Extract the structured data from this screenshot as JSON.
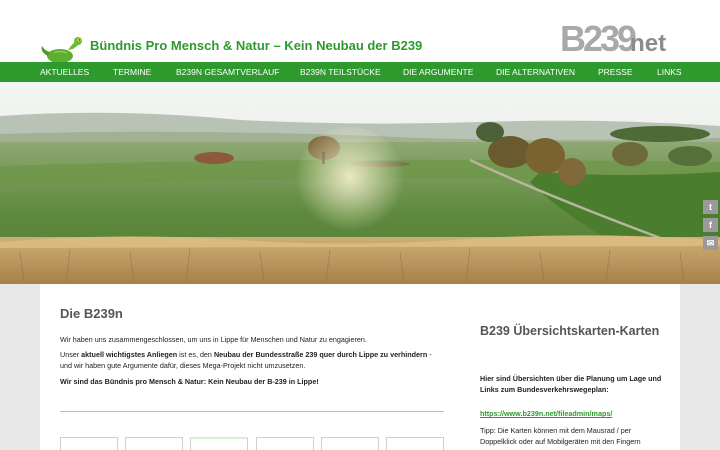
{
  "header": {
    "title": "Bündnis Pro Mensch & Natur – Kein Neubau der B239",
    "brand_main": "B239",
    "brand_sub": "net"
  },
  "nav": {
    "items": [
      {
        "label": "AKTUELLES"
      },
      {
        "label": "TERMINE"
      },
      {
        "label": "B239N GESAMTVERLAUF"
      },
      {
        "label": "B239N TEILSTÜCKE"
      },
      {
        "label": "DIE ARGUMENTE"
      },
      {
        "label": "DIE ALTERNATIVEN"
      },
      {
        "label": "PRESSE"
      },
      {
        "label": "LINKS"
      }
    ]
  },
  "share": {
    "twitter": "t",
    "facebook": "f",
    "email": "✉"
  },
  "main": {
    "title": "Die B239n",
    "p1": "Wir haben uns zusammengeschlossen, um uns in Lippe für Menschen und Natur zu engagieren.",
    "p2_a": "Unser ",
    "p2_b": "aktuell wichtigstes Anliegen",
    "p2_c": " ist es, den ",
    "p2_d": "Neubau der Bundesstraße 239 quer durch Lippe zu verhindern",
    "p2_e": " - und wir haben gute Argumente dafür, dieses Mega-Projekt nicht umzusetzen.",
    "p3": "Wir sind das Bündnis pro Mensch & Natur: Kein Neubau der B-239 in Lippe!"
  },
  "sidebar": {
    "title": "B239 Übersichtskarten-Karten",
    "intro": "Hier sind Übersichten über die Planung um Lage und Links zum Bundesverkehrswegeplan:",
    "link": "https://www.b239n.net/fileadmin/maps/",
    "tip": "Tipp: Die Karten können mit dem Mausrad / per Doppelklick oder auf Mobilgeräten mit den Fingern"
  },
  "colors": {
    "brand_green": "#2e9a2e",
    "nav_bg": "#2e9a2e",
    "page_bg": "#e8e8e8"
  }
}
